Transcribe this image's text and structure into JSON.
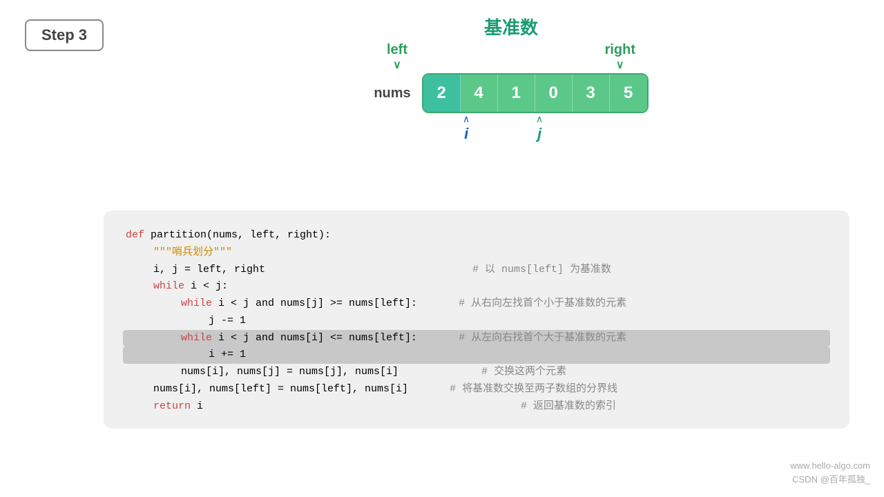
{
  "step": {
    "label": "Step  3"
  },
  "viz": {
    "pivot_label": "基准数",
    "left_pointer": "left",
    "right_pointer": "right",
    "nums_label": "nums",
    "array": [
      {
        "value": "2",
        "type": "highlight"
      },
      {
        "value": "4",
        "type": "normal"
      },
      {
        "value": "1",
        "type": "normal"
      },
      {
        "value": "0",
        "type": "normal"
      },
      {
        "value": "3",
        "type": "normal"
      },
      {
        "value": "5",
        "type": "normal"
      }
    ],
    "i_label": "i",
    "j_label": "j"
  },
  "code": {
    "lines": [
      {
        "indent": 0,
        "text": "def partition(nums, left, right):",
        "highlight": false
      },
      {
        "indent": 1,
        "text": "\"\"\"哨兵划分\"\"\"",
        "highlight": false
      },
      {
        "indent": 1,
        "text": "i, j = left, right",
        "highlight": false,
        "comment": "# 以 nums[left] 为基准数"
      },
      {
        "indent": 1,
        "text": "while i < j:",
        "highlight": false
      },
      {
        "indent": 2,
        "text": "while i < j and nums[j] >= nums[left]:",
        "highlight": false,
        "comment": "# 从右向左找首个小于基准数的元素"
      },
      {
        "indent": 3,
        "text": "j -= 1",
        "highlight": false
      },
      {
        "indent": 2,
        "text": "while i < j and nums[i] <= nums[left]:",
        "highlight": true,
        "comment": "# 从左向右找首个大于基准数的元素"
      },
      {
        "indent": 3,
        "text": "i += 1",
        "highlight": true
      },
      {
        "indent": 2,
        "text": "nums[i], nums[j] = nums[j], nums[i]",
        "highlight": false,
        "comment": "# 交换这两个元素"
      },
      {
        "indent": 1,
        "text": "nums[i], nums[left] = nums[left], nums[i]",
        "highlight": false,
        "comment": "# 将基准数交换至两子数组的分界线"
      },
      {
        "indent": 1,
        "text": "return i",
        "highlight": false,
        "comment": "# 返回基准数的索引"
      }
    ]
  },
  "watermark": {
    "line1": "www.hello-algo.com",
    "line2": "CSDN @百年孤独_"
  }
}
